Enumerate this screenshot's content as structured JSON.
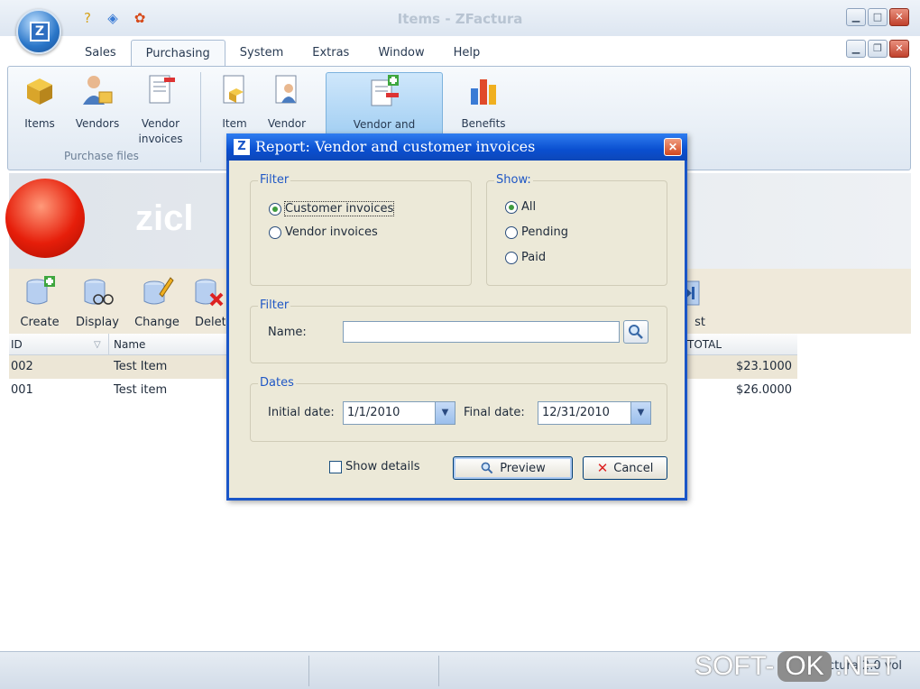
{
  "app": {
    "window_title": "Items - ZFactura",
    "orb_letter": "Z"
  },
  "quick_access": [
    "help-icon",
    "about-icon",
    "award-icon"
  ],
  "tabs": [
    {
      "label": "Sales"
    },
    {
      "label": "Purchasing",
      "active": true
    },
    {
      "label": "System"
    },
    {
      "label": "Extras"
    },
    {
      "label": "Window"
    },
    {
      "label": "Help"
    }
  ],
  "ribbon": {
    "group1_label": "Purchase files",
    "items_label": "Items",
    "vendors_label": "Vendors",
    "vendor_invoices_label": "Vendor invoices",
    "item_label": "Item",
    "vendor_label": "Vendor",
    "vendor_and_label": "Vendor and",
    "benefits_label": "Benefits"
  },
  "banner": {
    "text": "zicl"
  },
  "toolbar": {
    "create_label": "Create",
    "display_label": "Display",
    "change_label": "Change",
    "delete_label": "Delet",
    "last_label": "st"
  },
  "grid": {
    "columns": {
      "id": "ID",
      "name": "Name",
      "total": "TOTAL"
    },
    "rows": [
      {
        "id": "002",
        "name": "Test Item",
        "total": "$23.1000"
      },
      {
        "id": "001",
        "name": "Test item",
        "total": "$26.0000"
      }
    ]
  },
  "statusbar": {
    "text": "ZFactura 2.0 vol"
  },
  "watermark": {
    "left": "SOFT-",
    "ok": "OK",
    "right": ".NET"
  },
  "dialog": {
    "title": "Report: Vendor and customer invoices",
    "logo_letter": "Z",
    "filter_legend": "Filter",
    "filter_options": [
      "Customer invoices",
      "Vendor invoices"
    ],
    "show_legend": "Show:",
    "show_options": [
      "All",
      "Pending",
      "Paid"
    ],
    "name_filter_legend": "Filter",
    "name_label": "Name:",
    "name_value": "",
    "dates_legend": "Dates",
    "initial_date_label": "Initial date:",
    "initial_date_value": "1/1/2010",
    "final_date_label": "Final date:",
    "final_date_value": "12/31/2010",
    "show_details_label": "Show details",
    "preview_label": "Preview",
    "cancel_label": "Cancel"
  },
  "colors": {
    "dialog_title_blue": "#0a4fd0",
    "legend_blue": "#1f57c5",
    "radio_green": "#3e9b3e",
    "toolbar_bg": "#efe9da"
  }
}
